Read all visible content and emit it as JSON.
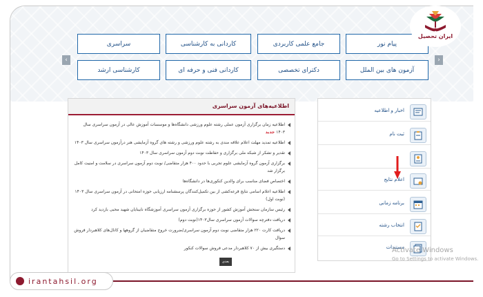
{
  "brand": {
    "logo_text": "ایران تحصیل",
    "site_url": "irantahsil.org"
  },
  "hero": {
    "row1": [
      "پیام نور",
      "جامع علمی کاربردی",
      "کاردانی به کارشناسی",
      "سراسری"
    ],
    "row2": [
      "آزمون های بین الملل",
      "دکترای تخصصی",
      "کاردانی فنی و حرفه ای",
      "کارشناسی ارشد"
    ],
    "arrow_prev": "‹",
    "arrow_next": "›"
  },
  "news_panel": {
    "title": "اطلاعیه‌های آزمون سراسری",
    "new_tag": "جدید",
    "items": [
      "اطلاعیه زمان برگزاری آزمون عملی رشته علوم ورزشی دانشگاه‌ها و موسسات آموزش عالی در آزمون سراسری سال ۱۴۰۳",
      "اطلاعیه تمدید مهلت اعلام علاقه مندی به رشته علوم ورزشی و رشته های گروه آزمایشی هنر درآزمون سراسری سال ۱۴۰۳",
      "تقدیر و تشکر از شبکه ملی برگزاری و حفاظت نوبت دوم آزمون سراسری سال ۱۴۰۳",
      "برگزاری آزمون گروه آزمایشی علوم تجربی با حدود ۴۰۰ هزار متقاضی/ نوبت دوم آزمون سراسری در سلامت و امنیت کامل برگزار شد",
      "اختصاص فضای مناسب برای والدین کنکوری‌ها در دانشگاه‌ها",
      "اطلاعیه اعلام اسامی نتایج قرعه‌کشی از بین تکمیل‌کنندگان پرسشنامه ارزیابی حوزه امتحانی در آزمون سراسری سال ۱۴۰۳ (نوبت اول)",
      "رئیس سازمان سنجش آموزش کشور از حوزه برگزاری آزمون سراسری آموزشگاه نابینایان شهید محبی بازدید کرد",
      "دریافت دفترچه سوالات آزمون سراسری سال۱۴۰۳(نوبت دوم)",
      "دریافت کارت ۲۲۰ هزار متقاضی نوبت دوم آزمون سراسری/ضرورت خروج متقاضیان از گروهها و کانال‌های کلاهبردار فروش سوال",
      "دستگیری بیش از ۷۰ کلاهبردار مدعی فروش سوالات کنکور"
    ],
    "more_label": "بعدی"
  },
  "sidebar": {
    "items": [
      {
        "label": "اخبار و اطلاعیه",
        "icon": "news-icon"
      },
      {
        "label": "ثبت نام",
        "icon": "clipboard-icon"
      },
      {
        "label": "",
        "icon": "id-card-icon"
      },
      {
        "label": "اعلام نتایج",
        "icon": "results-icon"
      },
      {
        "label": "برنامه زمانی",
        "icon": "calendar-icon"
      },
      {
        "label": "انتخاب رشته",
        "icon": "checklist-icon"
      },
      {
        "label": "مستندات",
        "icon": "documents-icon"
      }
    ]
  },
  "watermark": {
    "line1": "Activate Windows",
    "line2": "Go to Settings to activate Windows."
  },
  "colors": {
    "brand": "#8d1a2f",
    "tile_border": "#1f66a8",
    "accent_arrow": "#e11d1d"
  }
}
